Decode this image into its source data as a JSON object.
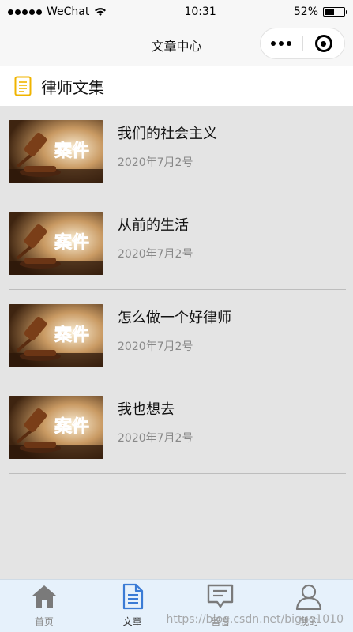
{
  "status_bar": {
    "carrier": "WeChat",
    "time": "10:31",
    "battery_percent": "52%",
    "battery_level": 0.52
  },
  "nav": {
    "title": "文章中心"
  },
  "section": {
    "title": "律师文集",
    "icon": "document-list-icon"
  },
  "articles": [
    {
      "title": "我们的社会主义",
      "date": "2020年7月2号",
      "thumb_text": "案件"
    },
    {
      "title": "从前的生活",
      "date": "2020年7月2号",
      "thumb_text": "案件"
    },
    {
      "title": "怎么做一个好律师",
      "date": "2020年7月2号",
      "thumb_text": "案件"
    },
    {
      "title": "我也想去",
      "date": "2020年7月2号",
      "thumb_text": "案件"
    }
  ],
  "tabs": [
    {
      "label": "首页",
      "icon": "home-icon",
      "active": false
    },
    {
      "label": "文章",
      "icon": "article-icon",
      "active": true
    },
    {
      "label": "留言",
      "icon": "message-icon",
      "active": false
    },
    {
      "label": "我的",
      "icon": "user-icon",
      "active": false
    }
  ],
  "watermark": "https://blog.csdn.net/biguo1010",
  "colors": {
    "accent": "#3a7bd5",
    "tab_bg": "#e6f1fb",
    "page_bg": "#e4e4e4",
    "icon_gold": "#f0b400"
  }
}
